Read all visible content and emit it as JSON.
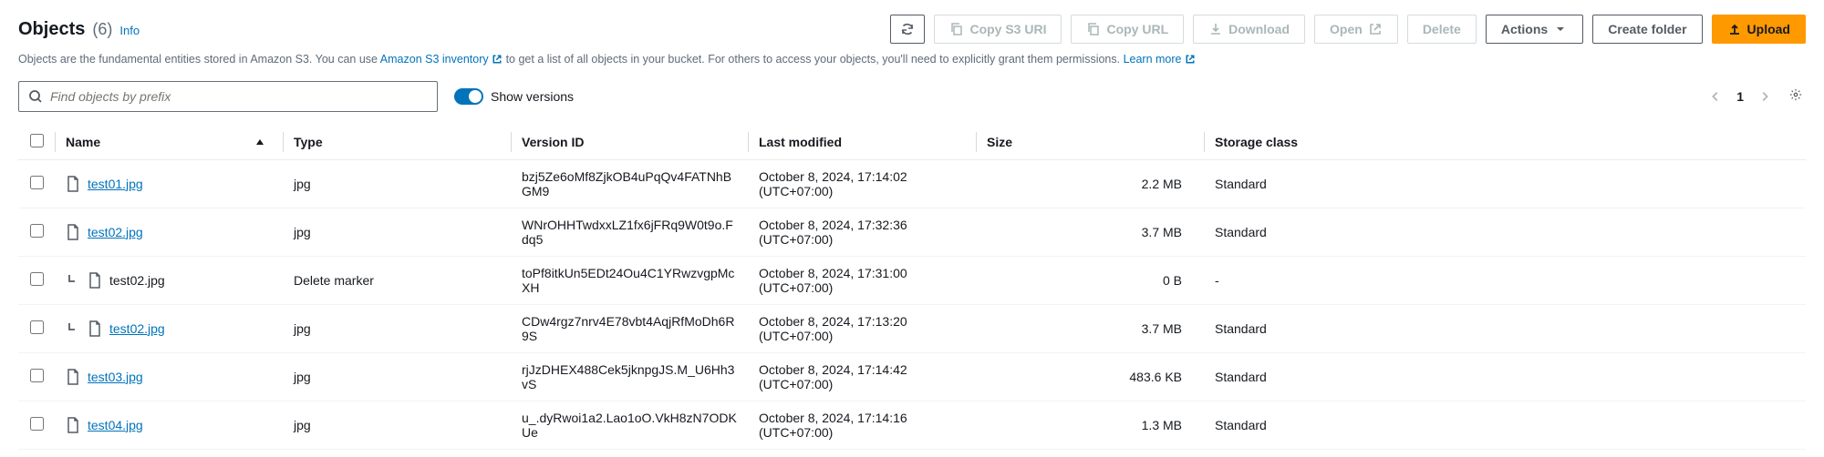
{
  "header": {
    "title": "Objects",
    "count": "(6)",
    "info": "Info"
  },
  "toolbar": {
    "copy_uri": "Copy S3 URI",
    "copy_url": "Copy URL",
    "download": "Download",
    "open": "Open",
    "delete": "Delete",
    "actions": "Actions",
    "create_folder": "Create folder",
    "upload": "Upload"
  },
  "description": {
    "p1": "Objects are the fundamental entities stored in Amazon S3. You can use ",
    "inventory_link": "Amazon S3 inventory",
    "p2": " to get a list of all objects in your bucket. For others to access your objects, you'll need to explicitly grant them permissions. ",
    "learn_more": "Learn more"
  },
  "search": {
    "placeholder": "Find objects by prefix"
  },
  "toggle": {
    "label": "Show versions"
  },
  "pagination": {
    "current": "1"
  },
  "columns": {
    "name": "Name",
    "type": "Type",
    "version_id": "Version ID",
    "last_modified": "Last modified",
    "size": "Size",
    "storage_class": "Storage class"
  },
  "rows": [
    {
      "name": "test01.jpg",
      "link": true,
      "nested": false,
      "type": "jpg",
      "version_id": "bzj5Ze6oMf8ZjkOB4uPqQv4FATNhBGM9",
      "last_modified": "October 8, 2024, 17:14:02 (UTC+07:00)",
      "size": "2.2 MB",
      "storage_class": "Standard"
    },
    {
      "name": "test02.jpg",
      "link": true,
      "nested": false,
      "type": "jpg",
      "version_id": "WNrOHHTwdxxLZ1fx6jFRq9W0t9o.Fdq5",
      "last_modified": "October 8, 2024, 17:32:36 (UTC+07:00)",
      "size": "3.7 MB",
      "storage_class": "Standard"
    },
    {
      "name": "test02.jpg",
      "link": false,
      "nested": true,
      "type": "Delete marker",
      "version_id": "toPf8itkUn5EDt24Ou4C1YRwzvgpMcXH",
      "last_modified": "October 8, 2024, 17:31:00 (UTC+07:00)",
      "size": "0 B",
      "storage_class": "-"
    },
    {
      "name": "test02.jpg",
      "link": true,
      "nested": true,
      "type": "jpg",
      "version_id": "CDw4rgz7nrv4E78vbt4AqjRfMoDh6R9S",
      "last_modified": "October 8, 2024, 17:13:20 (UTC+07:00)",
      "size": "3.7 MB",
      "storage_class": "Standard"
    },
    {
      "name": "test03.jpg",
      "link": true,
      "nested": false,
      "type": "jpg",
      "version_id": "rjJzDHEX488Cek5jknpgJS.M_U6Hh3vS",
      "last_modified": "October 8, 2024, 17:14:42 (UTC+07:00)",
      "size": "483.6 KB",
      "storage_class": "Standard"
    },
    {
      "name": "test04.jpg",
      "link": true,
      "nested": false,
      "type": "jpg",
      "version_id": "u_.dyRwoi1a2.Lao1oO.VkH8zN7ODKUe",
      "last_modified": "October 8, 2024, 17:14:16 (UTC+07:00)",
      "size": "1.3 MB",
      "storage_class": "Standard"
    }
  ]
}
